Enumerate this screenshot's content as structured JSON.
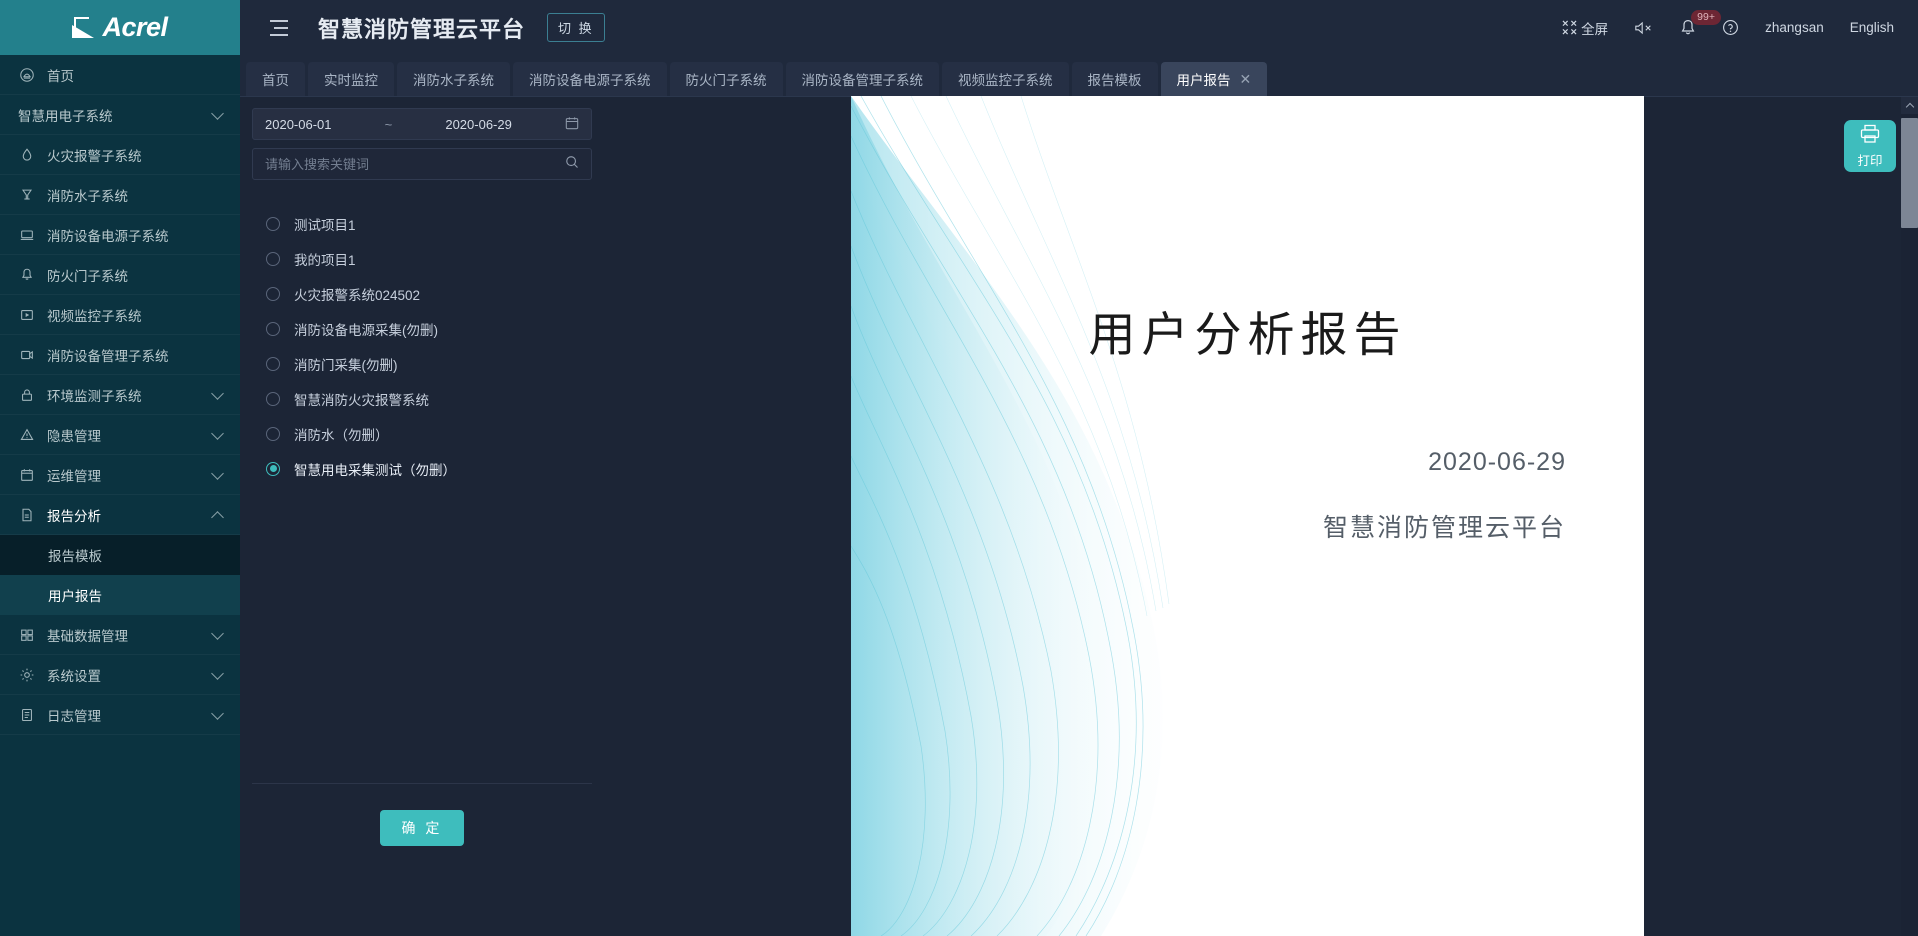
{
  "brand": {
    "name": "Acrel",
    "logo_icon": "acrel-logo-icon"
  },
  "colors": {
    "sidebar_bg": "#0b3340",
    "logo_bg": "#23808c",
    "app_bg": "#1c2536",
    "header_bg": "#1f293c",
    "accent_teal": "#3ebdbd",
    "active_tab_bg": "#39455c",
    "badge_bg": "#6d2634"
  },
  "sidebar": {
    "items": [
      {
        "label": "首页",
        "icon": "home-icon",
        "has_chevron": false,
        "expanded": false
      },
      {
        "label": "智慧用电子系统",
        "icon": "",
        "has_chevron": true,
        "expanded": false
      },
      {
        "label": "火灾报警子系统",
        "icon": "flame-icon",
        "has_chevron": false,
        "expanded": false
      },
      {
        "label": "消防水子系统",
        "icon": "water-icon",
        "has_chevron": false,
        "expanded": false
      },
      {
        "label": "消防设备电源子系统",
        "icon": "power-icon",
        "has_chevron": false,
        "expanded": false
      },
      {
        "label": "防火门子系统",
        "icon": "bell-icon",
        "has_chevron": false,
        "expanded": false
      },
      {
        "label": "视频监控子系统",
        "icon": "video-icon",
        "has_chevron": false,
        "expanded": false
      },
      {
        "label": "消防设备管理子系统",
        "icon": "device-icon",
        "has_chevron": false,
        "expanded": false
      },
      {
        "label": "环境监测子系统",
        "icon": "lock-icon",
        "has_chevron": true,
        "expanded": false
      },
      {
        "label": "隐患管理",
        "icon": "warning-icon",
        "has_chevron": true,
        "expanded": false
      },
      {
        "label": "运维管理",
        "icon": "calendar-icon",
        "has_chevron": true,
        "expanded": false
      },
      {
        "label": "报告分析",
        "icon": "report-icon",
        "has_chevron": true,
        "expanded": true
      }
    ],
    "submenu": [
      {
        "label": "报告模板",
        "active": false
      },
      {
        "label": "用户报告",
        "active": true
      }
    ],
    "items_after": [
      {
        "label": "基础数据管理",
        "icon": "grid-icon",
        "has_chevron": true,
        "expanded": false
      },
      {
        "label": "系统设置",
        "icon": "gear-icon",
        "has_chevron": true,
        "expanded": false
      },
      {
        "label": "日志管理",
        "icon": "log-icon",
        "has_chevron": true,
        "expanded": false
      }
    ]
  },
  "header": {
    "title": "智慧消防管理云平台",
    "switch_label": "切 换",
    "collapse_icon": "collapse-menu-icon",
    "fullscreen_label": "全屏",
    "fullscreen_icon": "fullscreen-icon",
    "mute_icon": "volume-mute-icon",
    "bell_icon": "bell-icon",
    "bell_badge": "99+",
    "help_icon": "question-circle-icon",
    "username": "zhangsan",
    "language": "English"
  },
  "tabs": [
    {
      "label": "首页",
      "active": false,
      "closable": false
    },
    {
      "label": "实时监控",
      "active": false,
      "closable": false
    },
    {
      "label": "消防水子系统",
      "active": false,
      "closable": false
    },
    {
      "label": "消防设备电源子系统",
      "active": false,
      "closable": false
    },
    {
      "label": "防火门子系统",
      "active": false,
      "closable": false
    },
    {
      "label": "消防设备管理子系统",
      "active": false,
      "closable": false
    },
    {
      "label": "视频监控子系统",
      "active": false,
      "closable": false
    },
    {
      "label": "报告模板",
      "active": false,
      "closable": false
    },
    {
      "label": "用户报告",
      "active": true,
      "closable": true
    }
  ],
  "filter_panel": {
    "date_start": "2020-06-01",
    "date_separator": "~",
    "date_end": "2020-06-29",
    "calendar_icon": "calendar-icon",
    "search_placeholder": "请输入搜索关键词",
    "search_value": "",
    "search_icon": "search-icon",
    "projects": [
      {
        "label": "测试项目1",
        "selected": false
      },
      {
        "label": "我的项目1",
        "selected": false
      },
      {
        "label": "火灾报警系统024502",
        "selected": false
      },
      {
        "label": "消防设备电源采集(勿删)",
        "selected": false
      },
      {
        "label": "消防门采集(勿删)",
        "selected": false
      },
      {
        "label": "智慧消防火灾报警系统",
        "selected": false
      },
      {
        "label": "消防水（勿删）",
        "selected": false
      },
      {
        "label": "智慧用电采集测试（勿删）",
        "selected": true
      }
    ],
    "confirm_label": "确 定"
  },
  "report": {
    "title": "用户分析报告",
    "date": "2020-06-29",
    "subtitle": "智慧消防管理云平台"
  },
  "print_button": {
    "label": "打印",
    "icon": "printer-icon"
  }
}
